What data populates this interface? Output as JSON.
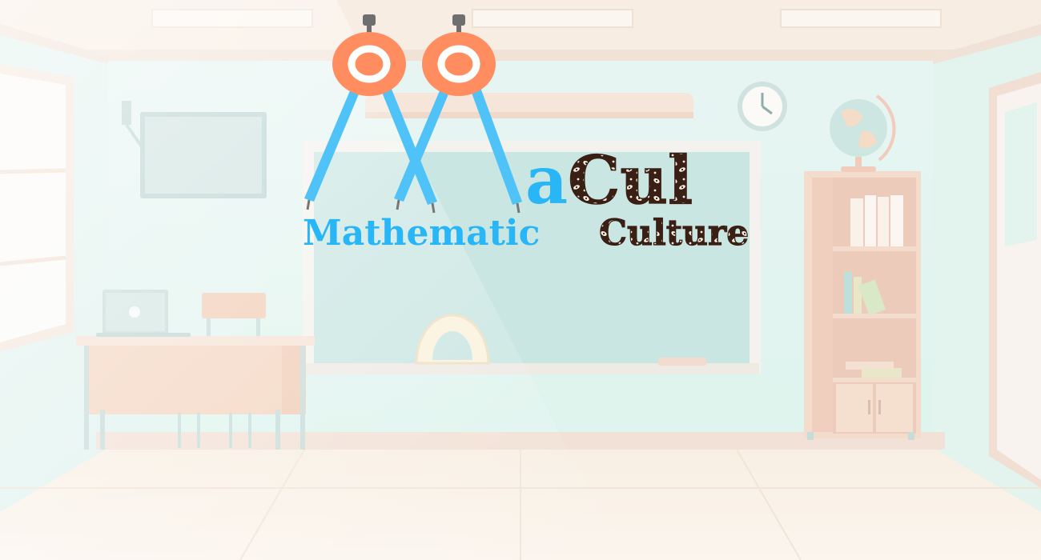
{
  "logo": {
    "brand_suffix": "aCul",
    "brand_suffix_part1": "a",
    "brand_suffix_part2": "Cul",
    "word1": "Mathematic",
    "word2": "Culture",
    "colors": {
      "compass_head": "#ff8d60",
      "compass_leg": "#4fc3f7",
      "word1": "#29b6f6",
      "batik_dark": "#3a1f14",
      "batik_light": "#f4ece2"
    }
  },
  "scene": {
    "colors": {
      "wall": "#dff3ef",
      "floor": "#f7efe5",
      "chalkboard": "#cde9e6",
      "frame": "#f1efe9",
      "wood": "#f4d9c2"
    },
    "icons": [
      "compass-icon",
      "clock-icon",
      "globe-icon",
      "laptop-icon",
      "tv-icon",
      "protractor-icon"
    ]
  }
}
